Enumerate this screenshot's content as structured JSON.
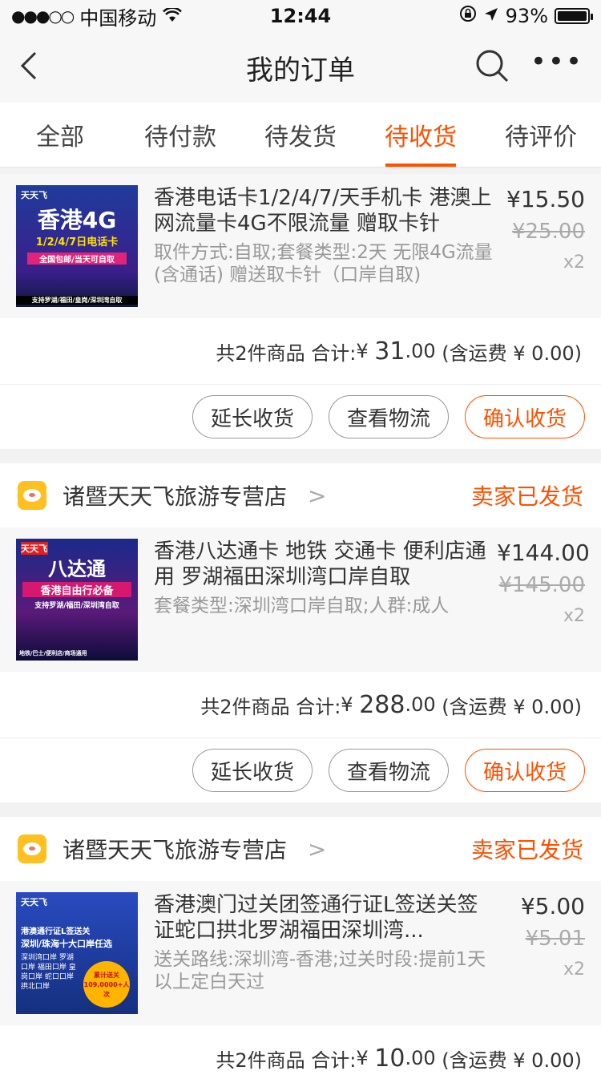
{
  "status_bar": {
    "carrier": "中国移动",
    "time": "12:44",
    "battery": "93%"
  },
  "nav": {
    "title": "我的订单"
  },
  "tabs": [
    "全部",
    "待付款",
    "待发货",
    "待收货",
    "待评价"
  ],
  "orders": [
    {
      "item": {
        "title": "香港电话卡1/2/4/7/天手机卡 港澳上网流量卡4G不限流量 赠取卡针",
        "spec": "取件方式:自取;套餐类型:2天 无限4G流量(含通话) 赠送取卡针（口岸自取)",
        "price": "¥15.50",
        "orig_price": "¥25.00",
        "qty": "x2",
        "thumb_lines": [
          "天天飞",
          "香港4G",
          "1/2/4/7日电话卡",
          "全国包邮/当天可自取",
          "支持罗湖/福田/皇岗/深圳湾自取"
        ]
      },
      "summary": {
        "count": "共2件商品",
        "label": "合计:",
        "currency": "¥",
        "int": "31",
        "dec": ".00",
        "ship": "(含运费 ¥ 0.00)"
      },
      "buttons": [
        "延长收货",
        "查看物流",
        "确认收货"
      ]
    },
    {
      "shop": {
        "name": "诸暨天天飞旅游专营店",
        "status": "卖家已发货"
      },
      "item": {
        "title": "香港八达通卡 地铁 交通卡 便利店通用 罗湖福田深圳湾口岸自取",
        "spec": "套餐类型:深圳湾口岸自取;人群:成人",
        "price": "¥144.00",
        "orig_price": "¥145.00",
        "qty": "x2",
        "thumb_lines": [
          "天天飞",
          "八达通",
          "香港自由行必备",
          "支持罗湖/福田/深圳湾自取",
          "地铁/巴士/便利店/商场通用"
        ]
      },
      "summary": {
        "count": "共2件商品",
        "label": "合计:",
        "currency": "¥",
        "int": "288",
        "dec": ".00",
        "ship": "(含运费 ¥ 0.00)"
      },
      "buttons": [
        "延长收货",
        "查看物流",
        "确认收货"
      ]
    },
    {
      "shop": {
        "name": "诸暨天天飞旅游专营店",
        "status": "卖家已发货"
      },
      "item": {
        "title": "香港澳门过关团签通行证L签送关签证蛇口拱北罗湖福田深圳湾...",
        "spec": "送关路线:深圳湾-香港;过关时段:提前1天以上定白天过",
        "price": "¥5.00",
        "orig_price": "¥5.01",
        "qty": "x2",
        "thumb_lines": [
          "天天飞",
          "港澳通行证L签送关",
          "深圳/珠海十大口岸任选",
          "深圳湾口岸 罗湖口岸 福田口岸 皇岗口岸 蛇口口岸 拱北口岸",
          "累计送关109,0000+人次"
        ]
      },
      "summary": {
        "count": "共2件商品",
        "label": "合计:",
        "currency": "¥",
        "int": "10",
        "dec": ".00",
        "ship": "(含运费 ¥ 0.00)"
      }
    }
  ],
  "colors": {
    "accent": "#ff5000"
  }
}
